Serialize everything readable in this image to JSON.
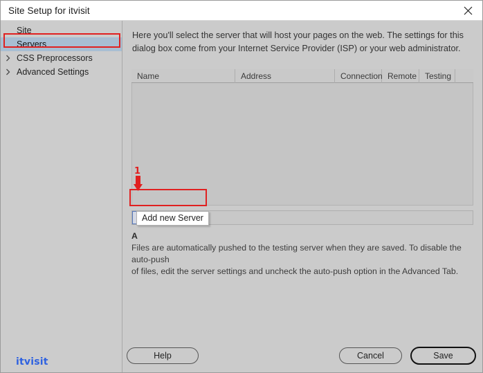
{
  "window": {
    "title": "Site Setup for itvisit",
    "close_icon": "close-icon"
  },
  "sidebar": {
    "items": [
      {
        "label": "Site",
        "expandable": false,
        "selected": false
      },
      {
        "label": "Servers",
        "expandable": false,
        "selected": true
      },
      {
        "label": "CSS Preprocessors",
        "expandable": true,
        "selected": false
      },
      {
        "label": "Advanced Settings",
        "expandable": true,
        "selected": false
      }
    ],
    "watermark": "itvisit"
  },
  "main": {
    "intro": "Here you'll select the server that will host your pages on the web. The settings for this dialog box come from your Internet Service Provider (ISP) or your web administrator.",
    "table": {
      "columns": [
        "Name",
        "Address",
        "Connection",
        "Remote",
        "Testing"
      ],
      "rows": []
    },
    "toolbar": {
      "buttons": [
        {
          "name": "add-server-button",
          "icon": "plus-icon",
          "enabled": true
        },
        {
          "name": "remove-server-button",
          "icon": "minus-icon",
          "enabled": false
        },
        {
          "name": "edit-server-button",
          "icon": "pencil-icon",
          "enabled": false
        },
        {
          "name": "duplicate-server-button",
          "icon": "duplicate-icon",
          "enabled": false
        }
      ]
    },
    "tooltip": "Add new Server",
    "note": {
      "line1": "A",
      "line2": "Files are automatically pushed to the testing server when they are saved. To disable the auto-push",
      "line3": "of files, edit the server settings and uncheck the auto-push option in the Advanced Tab."
    }
  },
  "footer": {
    "help_label": "Help",
    "cancel_label": "Cancel",
    "save_label": "Save"
  },
  "annotations": {
    "step_number": "1",
    "accent_color": "#e02020"
  }
}
